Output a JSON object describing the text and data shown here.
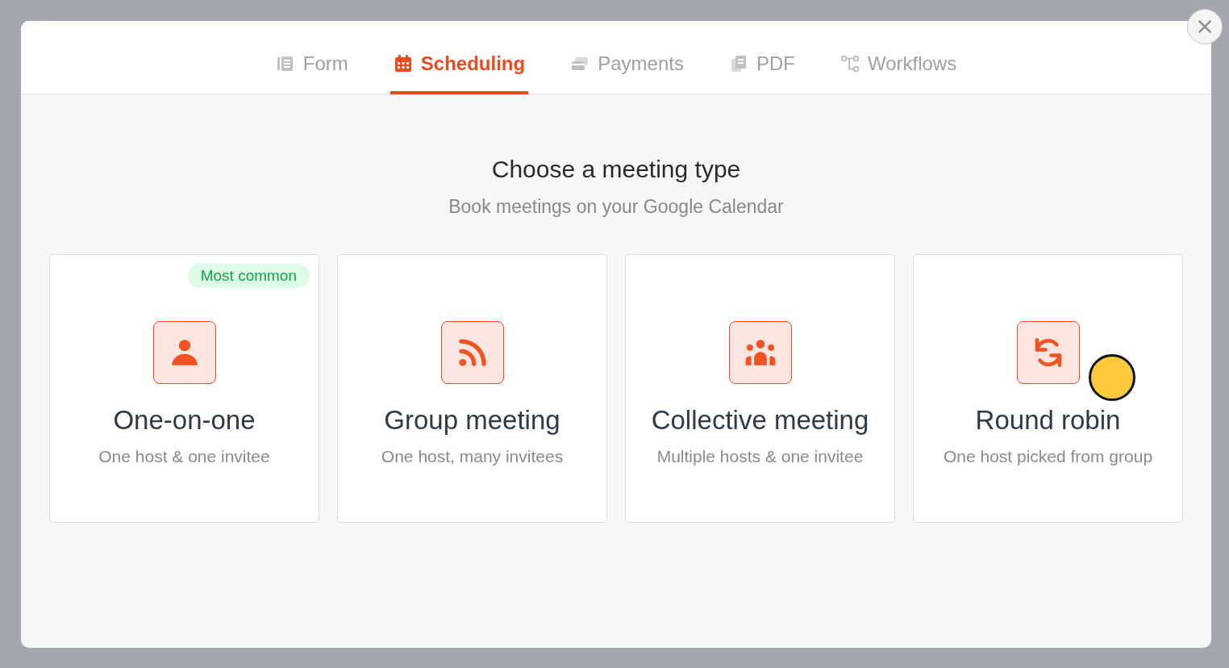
{
  "tabs": [
    {
      "label": "Form",
      "kind": "form",
      "selected": false
    },
    {
      "label": "Scheduling",
      "kind": "calendar",
      "selected": true
    },
    {
      "label": "Payments",
      "kind": "payments",
      "selected": false
    },
    {
      "label": "PDF",
      "kind": "pdf",
      "selected": false
    },
    {
      "label": "Workflows",
      "kind": "workflows",
      "selected": false
    }
  ],
  "heading": "Choose a meeting type",
  "subheading": "Book meetings on your Google Calendar",
  "meeting_types": [
    {
      "title": "One-on-one",
      "description": "One host & one invitee",
      "kind": "person",
      "badge": "Most common"
    },
    {
      "title": "Group meeting",
      "description": "One host, many invitees",
      "kind": "rss"
    },
    {
      "title": "Collective meeting",
      "description": "Multiple hosts & one invitee",
      "kind": "people"
    },
    {
      "title": "Round robin",
      "description": "One host picked from group",
      "kind": "sync"
    }
  ]
}
